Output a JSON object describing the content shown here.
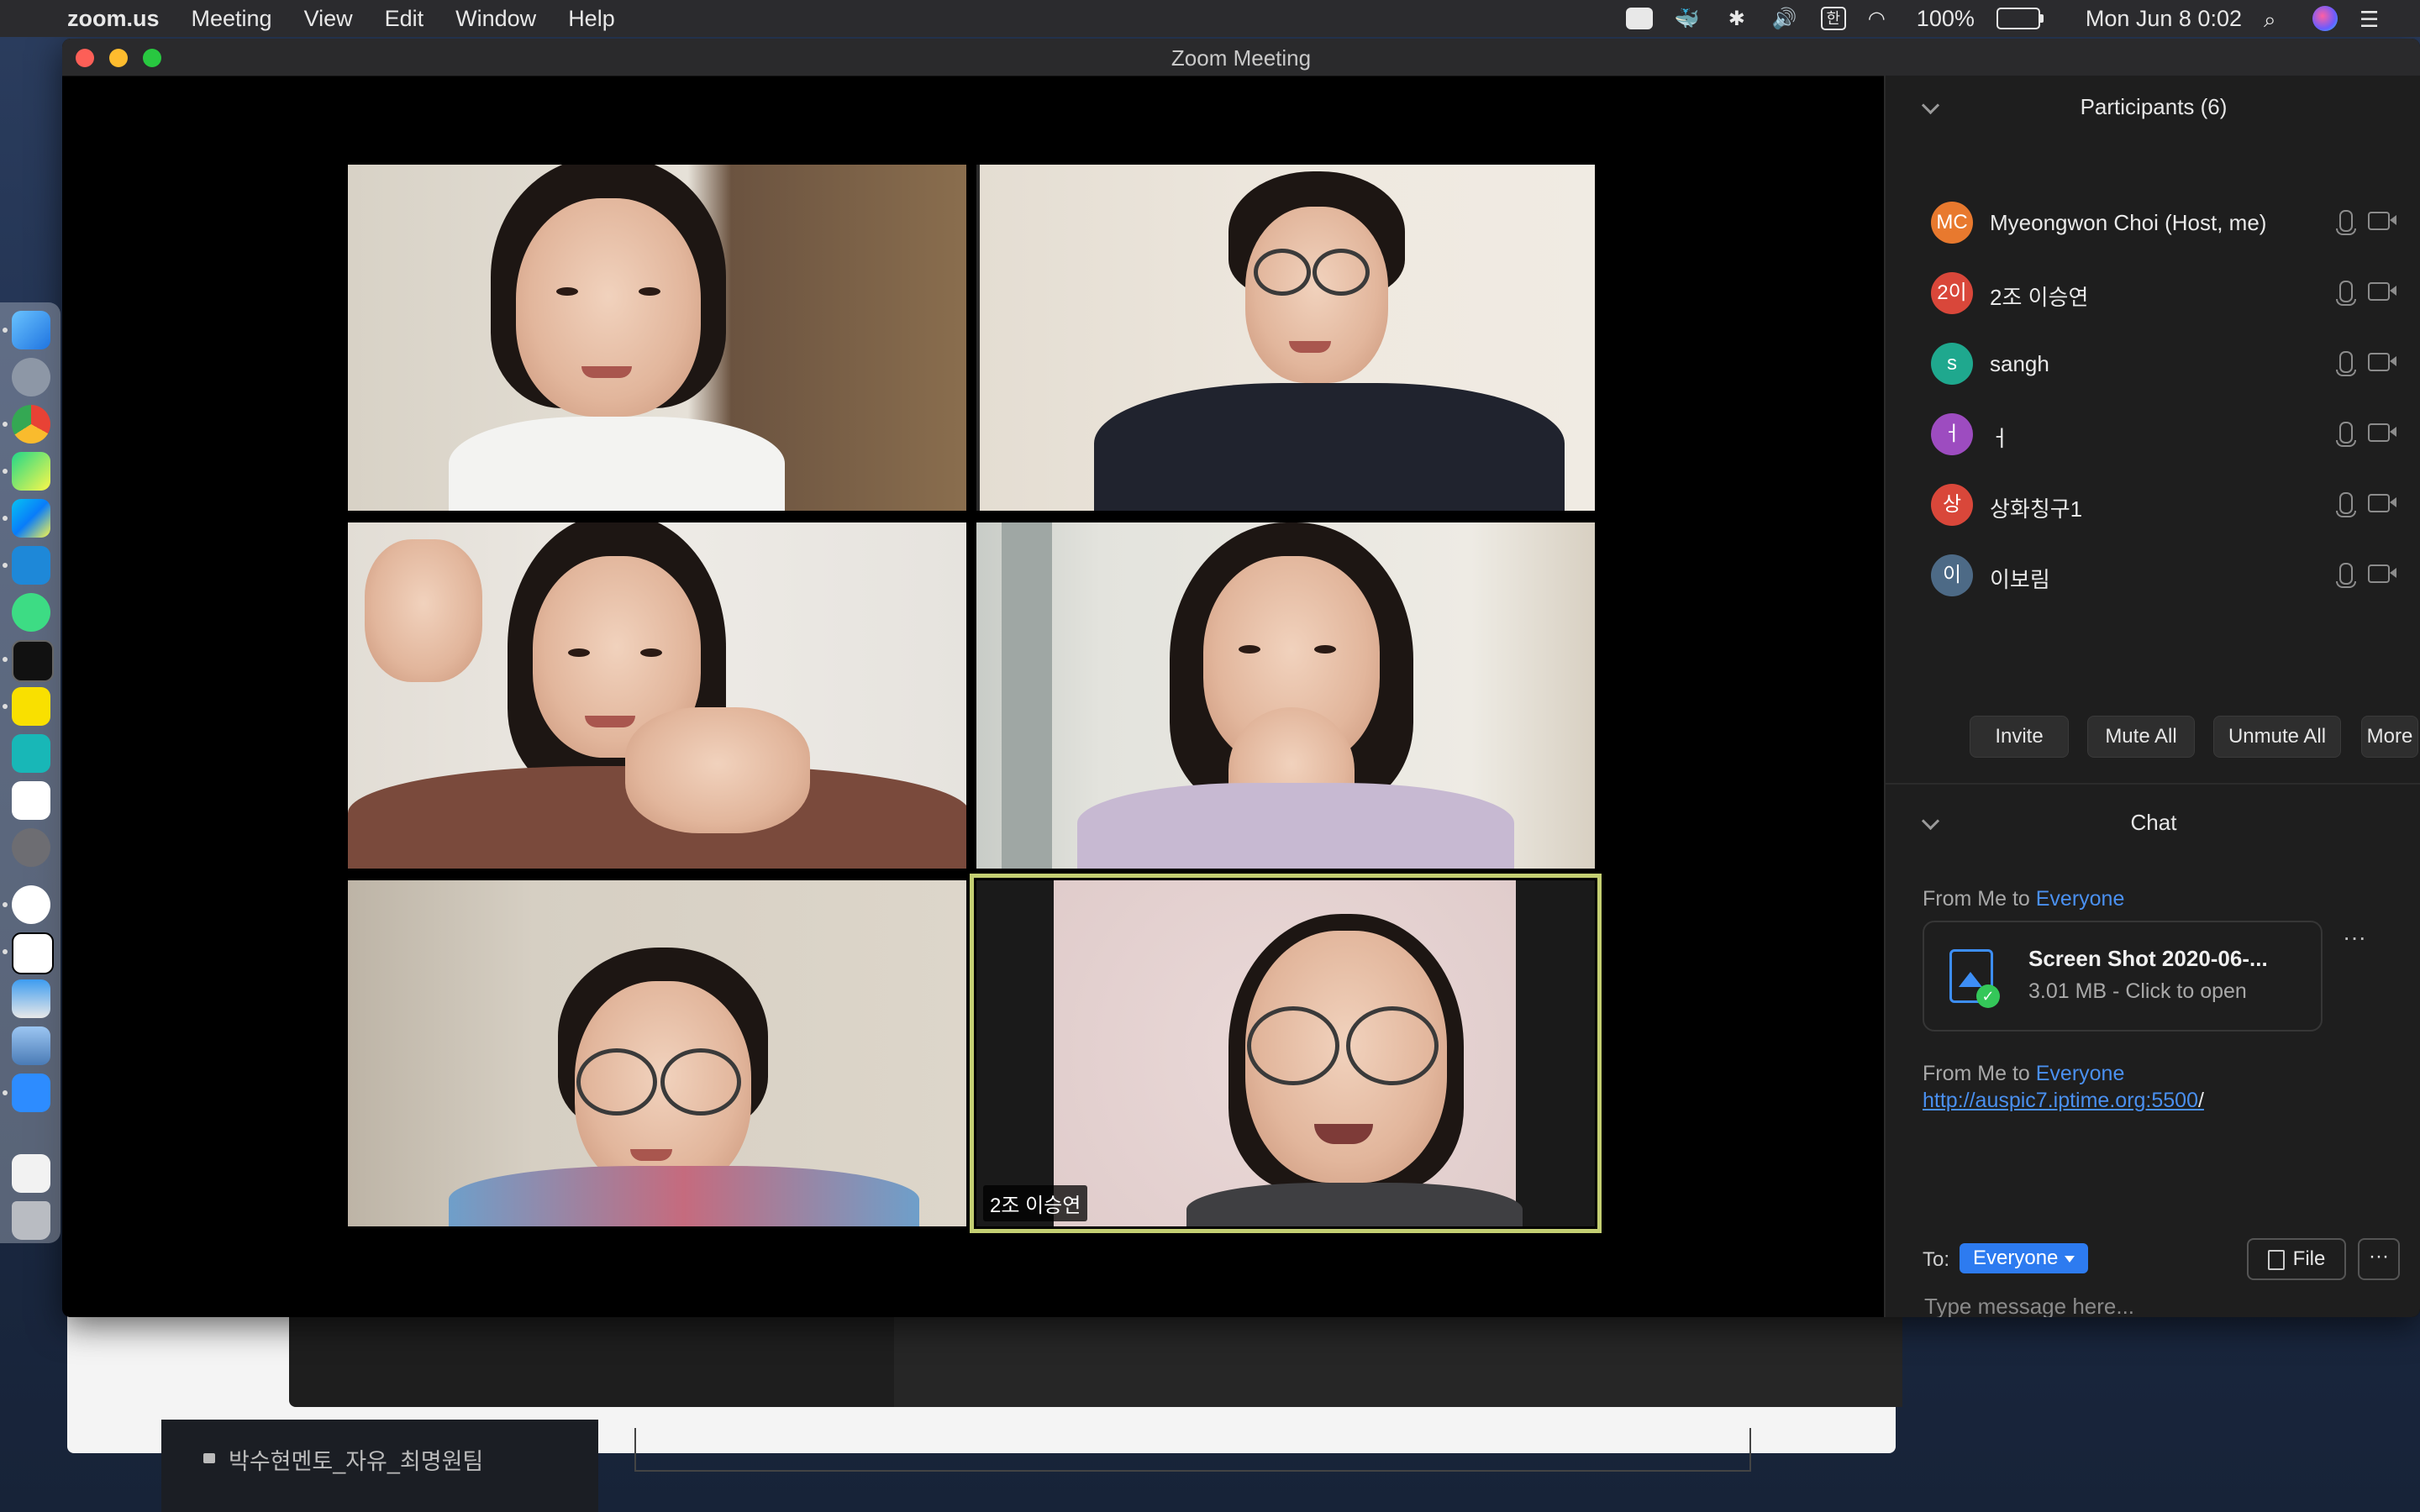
{
  "menubar": {
    "apple": "",
    "app_name": "zoom.us",
    "items": [
      "Meeting",
      "View",
      "Edit",
      "Window",
      "Help"
    ],
    "input_source": "한",
    "battery": "100%",
    "datetime": "Mon Jun 8  0:02"
  },
  "window": {
    "title": "Zoom Meeting"
  },
  "video": {
    "active_speaker_label": "2조 이승연"
  },
  "participants": {
    "header": "Participants (6)",
    "list": [
      {
        "initials": "MC",
        "name": "Myeongwon Choi (Host, me)",
        "color": "#e8792e"
      },
      {
        "initials": "2이",
        "name": "2조 이승연",
        "color": "#d9473a"
      },
      {
        "initials": "s",
        "name": "sangh",
        "color": "#1fa88e"
      },
      {
        "initials": "ㅓ",
        "name": "ㅓ",
        "color": "#9d4cc0"
      },
      {
        "initials": "상",
        "name": "상화칭구1",
        "color": "#d9473a"
      },
      {
        "initials": "이",
        "name": "이보림",
        "color": "#4d6a86"
      }
    ],
    "buttons": {
      "invite": "Invite",
      "mute_all": "Mute All",
      "unmute_all": "Unmute All",
      "more": "More"
    }
  },
  "chat": {
    "header": "Chat",
    "messages": [
      {
        "from_prefix": "From Me to ",
        "to": "Everyone",
        "file_name": "Screen Shot 2020-06-...",
        "file_meta": "3.01 MB - Click to open",
        "more": "···"
      },
      {
        "from_prefix": "From Me to ",
        "to": "Everyone",
        "link": "http://auspic7.iptime.org:5500",
        "link_suffix": "/"
      }
    ],
    "to_label": "To:",
    "to_value": "Everyone",
    "file_button": "File",
    "more_button": "···",
    "placeholder": "Type message here..."
  },
  "background": {
    "channel_label": "박수현멘토_자유_최명원팀"
  }
}
